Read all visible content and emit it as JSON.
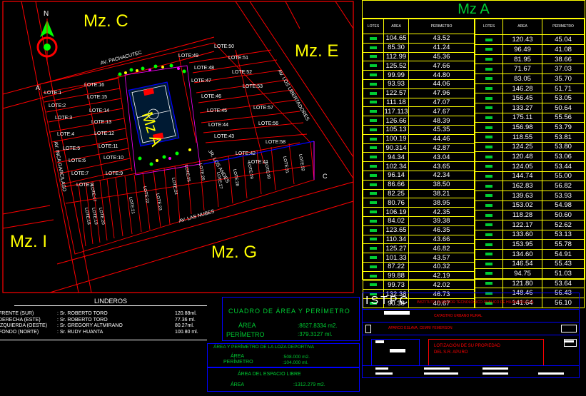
{
  "map": {
    "blocks": [
      "Mz. C",
      "Mz. E",
      "Mz. I",
      "Mz. G"
    ],
    "center_label": "Mz A",
    "streets": [
      "AV. PACHACUTEC",
      "AV. LAS NUBES",
      "AV. LOS LIBERTADORES",
      "AV. INCA GARCILASO",
      "JR. LOS ANDES"
    ],
    "points": [
      "A",
      "B",
      "C"
    ],
    "north": "N",
    "lotes_left": [
      "LOTE:1",
      "LOTE:2",
      "LOTE:3",
      "LOTE:4",
      "LOTE:5",
      "LOTE:6",
      "LOTE:7",
      "LOTE:8",
      "LOTE:9",
      "LOTE:10",
      "LOTE:11",
      "LOTE:12",
      "LOTE:13",
      "LOTE:14",
      "LOTE:15",
      "LOTE:16"
    ],
    "lotes_right": [
      "LOTE:50",
      "LOTE:49",
      "LOTE:48",
      "LOTE:47",
      "LOTE:51",
      "LOTE:52",
      "LOTE:53",
      "LOTE:46",
      "LOTE:45",
      "LOTE:44",
      "LOTE:43",
      "LOTE:42",
      "LOTE:41",
      "LOTE:57",
      "LOTE:58",
      "LOTE:56"
    ],
    "lotes_bottom": [
      "LOTE:17",
      "LOTE:18",
      "LOTE:19",
      "LOTE:20",
      "LOTE:21",
      "LOTE:22",
      "LOTE:23",
      "LOTE:24",
      "LOTE:25",
      "LOTE:26",
      "LOTE:27",
      "LOTE:28",
      "LOTE:29",
      "LOTE:30",
      "LOTE:31",
      "LOTE:32",
      "LOTE:33",
      "LOTE:34",
      "LOTE:35",
      "LOTE:36",
      "LOTE:37",
      "LOTE:38",
      "LOTE:39",
      "LOTE:40"
    ]
  },
  "table": {
    "title": "Mz A",
    "headers": [
      "LOTES",
      "AREA",
      "PERIMETRO",
      "LOTES",
      "AREA",
      "PERIMETRO"
    ],
    "left": [
      [
        "104.65",
        "43.52"
      ],
      [
        "85.30",
        "41.24"
      ],
      [
        "112.99",
        "45.36"
      ],
      [
        "125.52",
        "47.66"
      ],
      [
        "99.99",
        "44.80"
      ],
      [
        "93.93",
        "44.06"
      ],
      [
        "122.57",
        "47.96"
      ],
      [
        "111.18",
        "47.07"
      ],
      [
        "117.113",
        "47.67"
      ],
      [
        "126.66",
        "48.39"
      ],
      [
        "105.13",
        "45.35"
      ],
      [
        "100.19",
        "44.46"
      ],
      [
        "90.314",
        "42.87"
      ],
      [
        "94.34",
        "43.04"
      ],
      [
        "102.34",
        "43.65"
      ],
      [
        "96.14",
        "42.34"
      ],
      [
        "86.66",
        "38.50"
      ],
      [
        "82.25",
        "38.21"
      ],
      [
        "80.76",
        "38.95"
      ],
      [
        "106.19",
        "42.35"
      ],
      [
        "84.02",
        "39.38"
      ],
      [
        "123.65",
        "46.35"
      ],
      [
        "110.34",
        "43.66"
      ],
      [
        "125.27",
        "46.82"
      ],
      [
        "101.33",
        "43.57"
      ],
      [
        "87.22",
        "40.32"
      ],
      [
        "99.88",
        "42.19"
      ],
      [
        "99.73",
        "42.02"
      ],
      [
        "132.38",
        "46.73"
      ],
      [
        "90.38",
        "40.67"
      ]
    ],
    "right": [
      [
        "120.43",
        "45.04"
      ],
      [
        "96.49",
        "41.08"
      ],
      [
        "81.95",
        "38.66"
      ],
      [
        "71.67",
        "37.03"
      ],
      [
        "83.05",
        "35.70"
      ],
      [
        "146.28",
        "51.71"
      ],
      [
        "156.45",
        "53.05"
      ],
      [
        "133.27",
        "50.64"
      ],
      [
        "175.11",
        "55.56"
      ],
      [
        "156.98",
        "53.79"
      ],
      [
        "118.55",
        "53.81"
      ],
      [
        "124.25",
        "53.80"
      ],
      [
        "120.48",
        "53.06"
      ],
      [
        "124.05",
        "53.44"
      ],
      [
        "144.74",
        "55.00"
      ],
      [
        "162.83",
        "56.82"
      ],
      [
        "139.63",
        "53.93"
      ],
      [
        "153.02",
        "54.98"
      ],
      [
        "118.28",
        "50.60"
      ],
      [
        "122.17",
        "52.62"
      ],
      [
        "133.60",
        "53.13"
      ],
      [
        "153.95",
        "55.78"
      ],
      [
        "134.60",
        "54.91"
      ],
      [
        "146.54",
        "55.43"
      ],
      [
        "94.75",
        "51.03"
      ],
      [
        "121.80",
        "53.64"
      ],
      [
        "148.46",
        "56.43"
      ],
      [
        "141.64",
        "56.10"
      ]
    ]
  },
  "linderos": {
    "title": "LINDEROS",
    "rows": [
      [
        "FRENTE  (SUR)",
        ": Sr. ROBERTO TORO",
        "120.88ml."
      ],
      [
        "DERECHA  (ESTE)",
        ": Sr. ROBERTO TORO",
        "77.36 ml."
      ],
      [
        "IZQUIERDA  (OESTE)",
        ": Sr. GREGORY ALTMIRANO",
        "80.27ml."
      ],
      [
        "FONDO (NORTE)",
        ": Sr. RUDY HUANTA",
        "100.80 ml."
      ]
    ]
  },
  "cuadro": {
    "title": "CUADRO DE ÁREA Y PERÍMETRO",
    "area_label": "ÁREA",
    "area_value": ":8627.8334 m2.",
    "perimetro_label": "PERÍMETRO",
    "perimetro_value": ":379.3127 ml."
  },
  "loza": {
    "title": "ÁREA Y PERÍMETRO DE LA LOZA  DEPORTIVA",
    "area_label": "ÁREA",
    "area_value": ":508.000 m2.",
    "perimetro_label": "PERÍMETRO",
    "perimetro_value": ":104.000 ml."
  },
  "libre": {
    "title": "ÁREA   DEL ESPACIO LIBRE",
    "area_label": "ÁREA",
    "area_value": ":1312.279 m2."
  },
  "title_block": {
    "logo": "ISTPC",
    "institute": "INSTITUTO SUPERIOR TECNOLOGICO PUBLICO DE HUANCAVELICA",
    "project": "CATASTRO URBANO RURAL",
    "author": "APARCO ESLAVA, CEMRI YEMERSON",
    "description": "LOTIZACIÓN DE SU PROPIEDAD DEL S.R. APURO"
  },
  "colors": {
    "line": "#ff0000",
    "grid": "#ffff00",
    "text": "#ffffff",
    "accent": "#00cc33",
    "frame": "#0000ff"
  }
}
